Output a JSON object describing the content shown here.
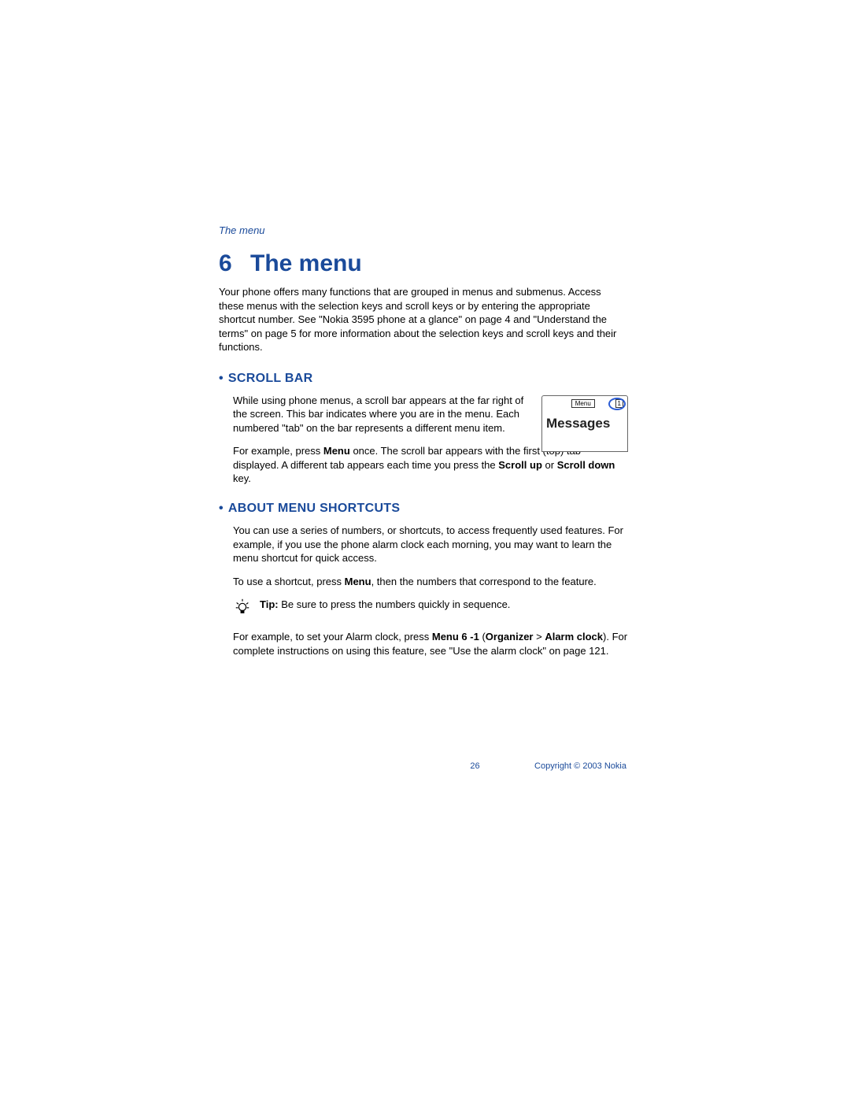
{
  "runningHeader": "The menu",
  "chapter": {
    "number": "6",
    "title": "The menu"
  },
  "intro": "Your phone offers many functions that are grouped in menus and submenus. Access these menus with the selection keys and scroll keys or by entering the appropriate shortcut number. See \"Nokia 3595 phone at a glance\" on page 4 and \"Understand the terms\" on page 5 for more information about the selection keys and scroll keys and their functions.",
  "sections": {
    "scrollBar": {
      "heading": "SCROLL BAR",
      "para1": "While using phone menus, a scroll bar appears at the far right of the screen. This bar indicates where you are in the menu. Each numbered \"tab\" on the bar represents a different menu item.",
      "para2a": "For example, press ",
      "para2b": "Menu",
      "para2c": " once. The scroll bar appears with the first (top) tab displayed. A different tab appears each time you press the ",
      "para2d": "Scroll up",
      "para2e": " or ",
      "para2f": "Scroll down",
      "para2g": " key.",
      "screenMenuLabel": "Menu",
      "screenTabNumber": "1",
      "screenBigText": "Messages"
    },
    "shortcuts": {
      "heading": "ABOUT MENU SHORTCUTS",
      "para1": "You can use a series of numbers, or shortcuts, to access frequently used features. For example, if you use the phone alarm clock each morning, you may want to learn the menu shortcut for quick access.",
      "para2a": "To use a shortcut, press ",
      "para2b": "Menu",
      "para2c": ", then the numbers that correspond to the feature.",
      "tipLabel": "Tip:",
      "tipText": " Be sure to press the numbers quickly in sequence.",
      "para3a": "For example, to set your Alarm clock, press ",
      "para3b": "Menu 6 -1",
      "para3c": " (",
      "para3d": "Organizer",
      "para3e": " > ",
      "para3f": "Alarm clock",
      "para3g": "). For complete instructions on using this feature, see \"Use the alarm clock\" on page 121."
    }
  },
  "footer": {
    "pageNumber": "26",
    "copyright": "Copyright © 2003 Nokia"
  }
}
